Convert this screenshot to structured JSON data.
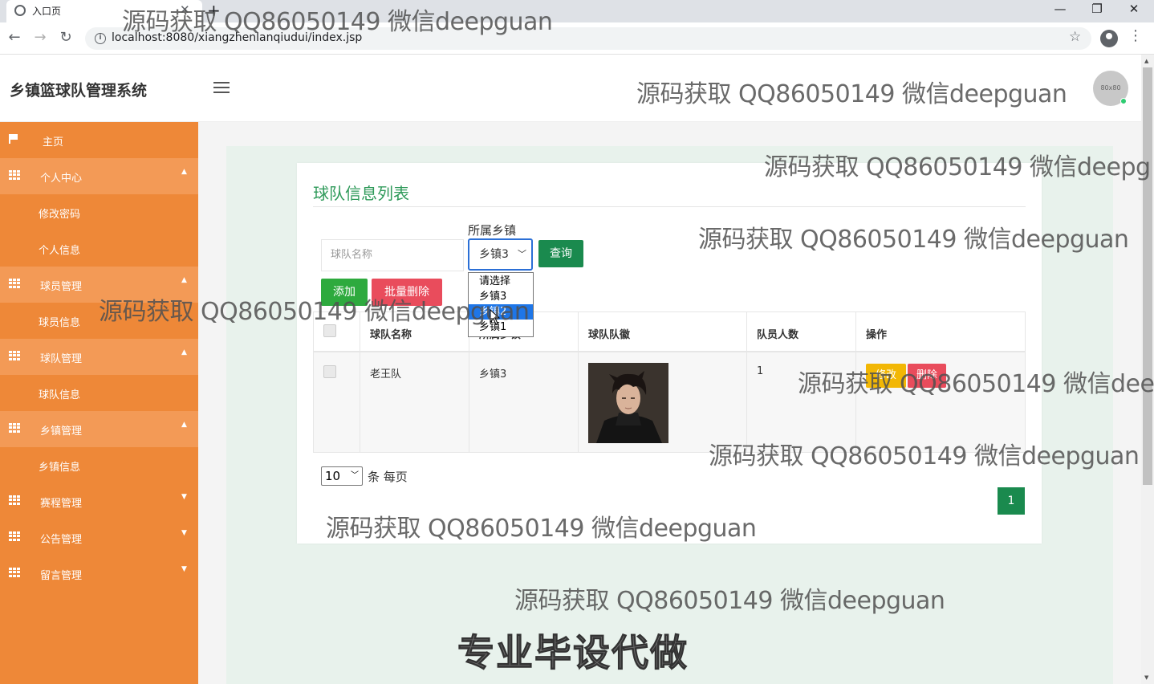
{
  "browser": {
    "tab_title": "入口页",
    "url": "localhost:8080/xiangzhenlanqiudui/index.jsp",
    "minimize": "—",
    "restore": "❐",
    "close": "✕",
    "tab_close": "✕",
    "new_tab": "+",
    "back": "←",
    "forward": "→",
    "reload": "↻",
    "star": "☆",
    "menu": "⋮",
    "info": "i"
  },
  "header": {
    "brand": "乡镇篮球队管理系统",
    "avatar_text": "80x80"
  },
  "sidebar": {
    "items": [
      {
        "label": "主页",
        "icon": "flag-icon"
      },
      {
        "label": "个人中心",
        "icon": "grid-icon",
        "caret": "▲"
      },
      {
        "label": "修改密码"
      },
      {
        "label": "个人信息"
      },
      {
        "label": "球员管理",
        "icon": "grid-icon",
        "caret": "▲"
      },
      {
        "label": "球员信息"
      },
      {
        "label": "球队管理",
        "icon": "grid-icon",
        "caret": "▲"
      },
      {
        "label": "球队信息"
      },
      {
        "label": "乡镇管理",
        "icon": "grid-icon",
        "caret": "▲"
      },
      {
        "label": "乡镇信息"
      },
      {
        "label": "赛程管理",
        "icon": "grid-icon",
        "caret": "▼"
      },
      {
        "label": "公告管理",
        "icon": "grid-icon",
        "caret": "▼"
      },
      {
        "label": "留言管理",
        "icon": "grid-icon",
        "caret": "▼"
      }
    ]
  },
  "main": {
    "title": "球队信息列表",
    "search_placeholder": "球队名称",
    "town_label": "所属乡镇",
    "town_selected": "乡镇3",
    "town_options": [
      "请选择",
      "乡镇3",
      "乡镇2",
      "乡镇1"
    ],
    "town_highlighted_index": 2,
    "query_button": "查询",
    "add_button": "添加",
    "batch_delete_button": "批量删除",
    "table": {
      "headers": [
        "球队名称",
        "所属乡镇",
        "球队队徽",
        "队员人数",
        "操作"
      ],
      "rows": [
        {
          "name": "老王队",
          "town": "乡镇3",
          "badge": "player-photo",
          "members": "1",
          "edit": "修改",
          "delete": "删除"
        }
      ]
    },
    "page_size": "10",
    "page_size_suffix": "条 每页",
    "current_page": "1"
  },
  "watermarks": {
    "text": "源码获取 QQ86050149 微信deepguan",
    "text_cut_1": "源码获取 QQ86050149 微信deepg",
    "text_cut_2": "源码获取 QQ86050149 微信dee",
    "promo": "专业毕设代做"
  },
  "colors": {
    "sidebar": "#ee8838",
    "accent_green": "#1a8a4e",
    "danger": "#e94c5c",
    "warning": "#f2b705"
  }
}
